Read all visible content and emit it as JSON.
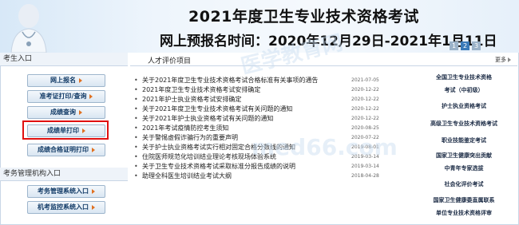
{
  "banner": {
    "title": "2021年度卫生专业技术资格考试",
    "subtitle": "网上预报名时间：2020年12月29日-2021年1月11日",
    "slides": [
      "1",
      "2",
      "3"
    ],
    "active_slide": "2"
  },
  "sidebar": {
    "candidate_section": "考生入口",
    "candidate_buttons": [
      "网上报名",
      "准考证打印/查询",
      "成绩查询",
      "成绩单打印",
      "成绩合格证明打印"
    ],
    "highlighted_button": "成绩单打印",
    "admin_section": "考务管理机构入口",
    "admin_buttons": [
      "考务管理系统入口",
      "机考监控系统入口"
    ]
  },
  "main": {
    "section_title": "人才评价项目",
    "more_label": "更多",
    "news": [
      {
        "title": "关于2021年度卫生专业技术资格考试合格标准有关事项的通告",
        "date": "2021-07-05"
      },
      {
        "title": "2021年度卫生专业技术资格考试安排确定",
        "date": "2020-12-22"
      },
      {
        "title": "2021年护士执业资格考试安排确定",
        "date": "2020-12-22"
      },
      {
        "title": "关于2021年度卫生专业技术资格考试有关问题的通知",
        "date": "2020-12-22"
      },
      {
        "title": "关于2021年护士执业资格考试有关问题的通知",
        "date": "2020-12-22"
      },
      {
        "title": "2021年考试疫情防控考生须知",
        "date": "2020-08-25"
      },
      {
        "title": "关于警惕虚假诈骗行为的重要声明",
        "date": "2020-07-22"
      },
      {
        "title": "关于护士执业资格考试实行相对固定合格分数线的通知",
        "date": "2019-08-01"
      },
      {
        "title": "住院医师规范化培训结业理论考核现场体验系统",
        "date": "2019-03-14"
      },
      {
        "title": "关于卫生专业技术资格考试采取标准分报告成绩的说明",
        "date": "2019-03-14"
      },
      {
        "title": "助理全科医生培训结业考试大纲",
        "date": "2018-04-28"
      }
    ],
    "categories": [
      "全国卫生专业技术资格",
      "考试（中初级）",
      "护士执业资格考试",
      "高级卫生专业技术资格考试",
      "职业技能鉴定考试",
      "国家卫生健康突出贡献",
      "中青年专家选拔",
      "社会化评价考试",
      "国家卫生健康委直属联系",
      "单位专业技术资格评审"
    ]
  },
  "watermark": {
    "text1": "医学教育网",
    "text2": "med66.com"
  }
}
